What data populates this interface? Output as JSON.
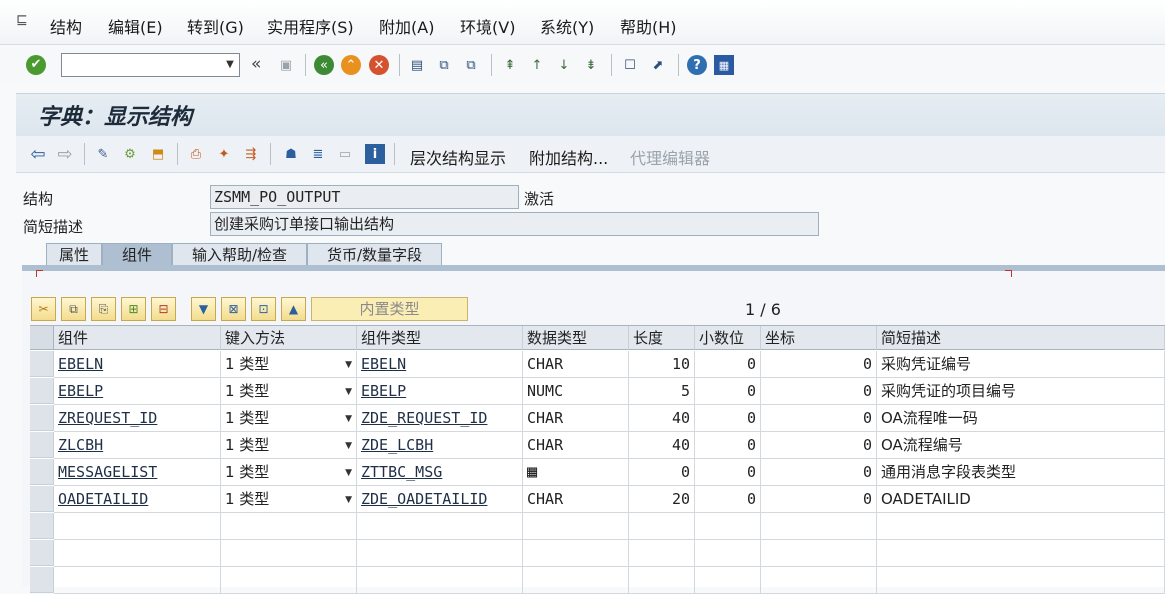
{
  "menu": [
    {
      "label": "结构"
    },
    {
      "label": "编辑(E)"
    },
    {
      "label": "转到(G)"
    },
    {
      "label": "实用程序(S)"
    },
    {
      "label": "附加(A)"
    },
    {
      "label": "环境(V)"
    },
    {
      "label": "系统(Y)"
    },
    {
      "label": "帮助(H)"
    }
  ],
  "command_field": {
    "value": ""
  },
  "title": "字典：显示结构",
  "app_toolbar": {
    "hierarchy_label": "层次结构显示",
    "append_label": "附加结构...",
    "proxy_label": "代理编辑器"
  },
  "header": {
    "structure_label": "结构",
    "structure_value": "ZSMM_PO_OUTPUT",
    "status": "激活",
    "desc_label": "简短描述",
    "desc_value": "创建采购订单接口输出结构"
  },
  "tabs": [
    {
      "label": "属性",
      "active": false
    },
    {
      "label": "组件",
      "active": true
    },
    {
      "label": "输入帮助/检查",
      "active": false
    },
    {
      "label": "货币/数量字段",
      "active": false
    }
  ],
  "table_toolbar": {
    "builtin_type_label": "内置类型",
    "page": "1 / 6"
  },
  "columns": [
    "组件",
    "键入方法",
    "组件类型",
    "数据类型",
    "长度",
    "小数位",
    "坐标",
    "简短描述"
  ],
  "rows": [
    {
      "component": "EBELN",
      "method": "1 类型",
      "comp_type": "EBELN",
      "data_type": "CHAR",
      "length": "10",
      "decimals": "0",
      "coord": "0",
      "desc": "采购凭证编号"
    },
    {
      "component": "EBELP",
      "method": "1 类型",
      "comp_type": "EBELP",
      "data_type": "NUMC",
      "length": "5",
      "decimals": "0",
      "coord": "0",
      "desc": "采购凭证的项目编号"
    },
    {
      "component": "ZREQUEST_ID",
      "method": "1 类型",
      "comp_type": "ZDE_REQUEST_ID",
      "data_type": "CHAR",
      "length": "40",
      "decimals": "0",
      "coord": "0",
      "desc": "OA流程唯一码"
    },
    {
      "component": "ZLCBH",
      "method": "1 类型",
      "comp_type": "ZDE_LCBH",
      "data_type": "CHAR",
      "length": "40",
      "decimals": "0",
      "coord": "0",
      "desc": "OA流程编号"
    },
    {
      "component": "MESSAGELIST",
      "method": "1 类型",
      "comp_type": "ZTTBC_MSG",
      "data_type": "",
      "length": "0",
      "decimals": "0",
      "coord": "0",
      "desc": "通用消息字段表类型"
    },
    {
      "component": "OADETAILID",
      "method": "1 类型",
      "comp_type": "ZDE_OADETAILID",
      "data_type": "CHAR",
      "length": "20",
      "decimals": "0",
      "coord": "0",
      "desc": "OADETAILID"
    }
  ],
  "colors": {
    "accent": "#aebfd1",
    "link": "#1f2f46",
    "button_yellow": "#f3dc8d"
  }
}
